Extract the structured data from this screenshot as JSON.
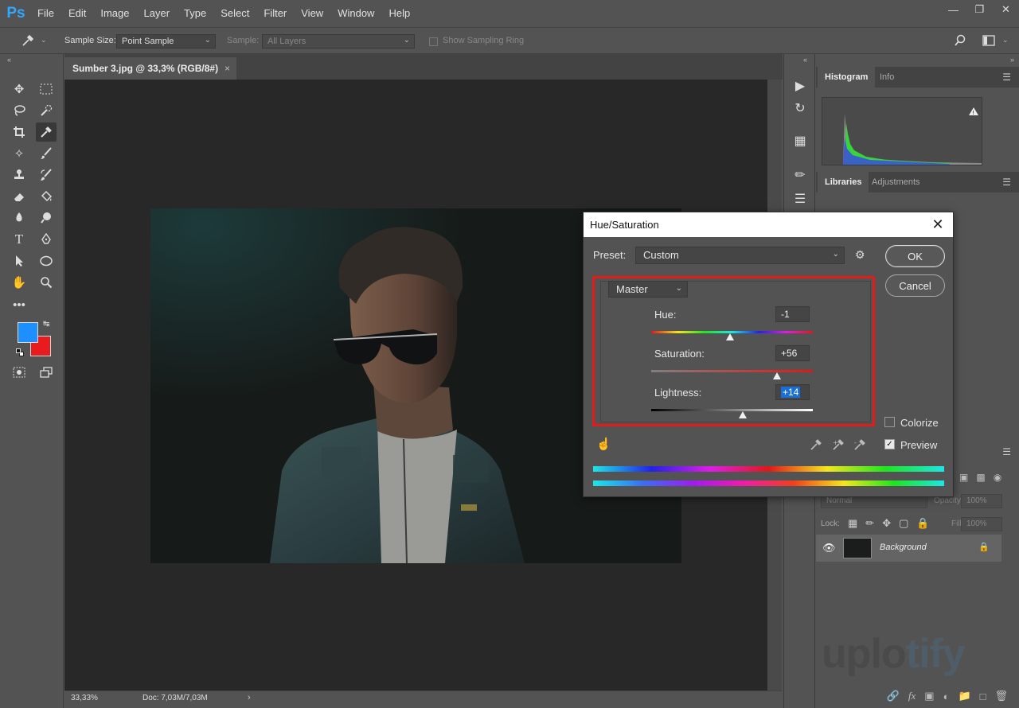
{
  "app": {
    "logo": "Ps",
    "menu": [
      "File",
      "Edit",
      "Image",
      "Layer",
      "Type",
      "Select",
      "Filter",
      "View",
      "Window",
      "Help"
    ],
    "window_controls": [
      "minimize",
      "restore",
      "close"
    ]
  },
  "options_bar": {
    "sample_size_label": "Sample Size:",
    "sample_size_value": "Point Sample",
    "sample_label": "Sample:",
    "sample_value": "All Layers",
    "show_sampling_ring": "Show Sampling Ring"
  },
  "document": {
    "tab_title": "Sumber 3.jpg @ 33,3% (RGB/8#)",
    "tab_close": "×",
    "zoom": "33,33%",
    "doc_size": "Doc: 7,03M/7,03M"
  },
  "toolbar": {
    "foreground_color": "#1e8fff",
    "background_color": "#e81c1c"
  },
  "panels": {
    "top_tabs": [
      "Histogram",
      "Info"
    ],
    "mid_tabs": [
      "Libraries",
      "Adjustments"
    ],
    "blend_mode": "Normal",
    "opacity_label": "Opacity:",
    "opacity_value": "100%",
    "lock_label": "Lock:",
    "fill_label": "Fill:",
    "fill_value": "100%",
    "layer_name": "Background"
  },
  "watermark": {
    "part1": "uplo",
    "part2": "tify"
  },
  "dialog": {
    "title": "Hue/Saturation",
    "preset_label": "Preset:",
    "preset_value": "Custom",
    "ok": "OK",
    "cancel": "Cancel",
    "channel": "Master",
    "hue_label": "Hue:",
    "hue_value": "-1",
    "saturation_label": "Saturation:",
    "saturation_value": "+56",
    "lightness_label": "Lightness:",
    "lightness_value": "+14",
    "colorize_label": "Colorize",
    "colorize_checked": false,
    "preview_label": "Preview",
    "preview_checked": true,
    "highlight_color": "#e31b1b"
  }
}
